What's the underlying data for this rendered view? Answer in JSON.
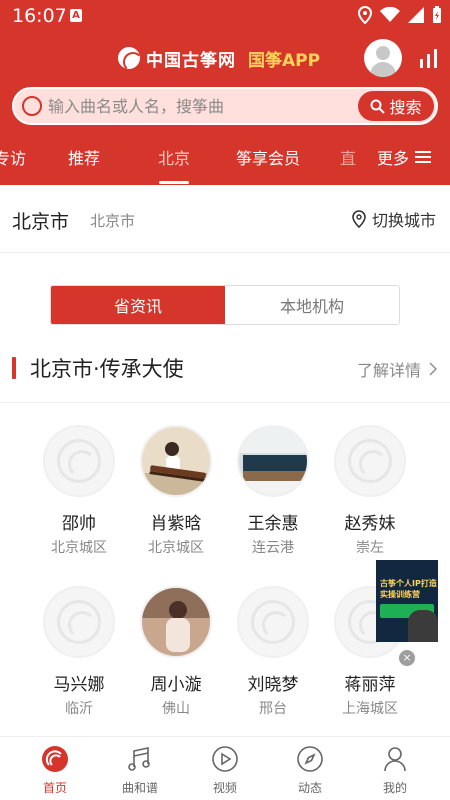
{
  "status": {
    "time": "16:07",
    "a_badge": "A"
  },
  "header": {
    "brand_name": "中国古筝网",
    "brand_app": "国筝APP"
  },
  "search": {
    "placeholder": "输入曲名或人名，搜筝曲",
    "button_label": "搜索"
  },
  "tabs": [
    {
      "label": "专访"
    },
    {
      "label": "推荐"
    },
    {
      "label": "北京",
      "active": true
    },
    {
      "label": "筝享会员"
    },
    {
      "label": "直"
    }
  ],
  "more_label": "更多",
  "city": {
    "name": "北京市",
    "sub": "北京市",
    "switch_label": "切换城市"
  },
  "segment": {
    "active": "省资讯",
    "inactive": "本地机构"
  },
  "section": {
    "title": "北京市·传承大使",
    "more": "了解详情"
  },
  "people": [
    {
      "name": "邵帅",
      "location": "北京城区",
      "photo": "placeholder-logo"
    },
    {
      "name": "肖紫晗",
      "location": "北京城区",
      "photo": "guzheng-player-photo"
    },
    {
      "name": "王余惠",
      "location": "连云港",
      "photo": "guzheng-instrument-photo"
    },
    {
      "name": "赵秀妹",
      "location": "崇左",
      "photo": "placeholder-logo"
    },
    {
      "name": "马兴娜",
      "location": "临沂",
      "photo": "placeholder-logo"
    },
    {
      "name": "周小漩",
      "location": "佛山",
      "photo": "player-portrait-photo"
    },
    {
      "name": "刘晓梦",
      "location": "邢台",
      "photo": "placeholder-logo"
    },
    {
      "name": "蒋丽萍",
      "location": "上海城区",
      "photo": "placeholder-logo"
    }
  ],
  "ad": {
    "text_line1": "古筝个人IP打造",
    "text_line2": "实操训练营",
    "close": "×"
  },
  "bottom_nav": [
    {
      "label": "首页",
      "icon": "home-icon",
      "active": true
    },
    {
      "label": "曲和谱",
      "icon": "score-icon"
    },
    {
      "label": "视频",
      "icon": "video-icon"
    },
    {
      "label": "动态",
      "icon": "compass-icon"
    },
    {
      "label": "我的",
      "icon": "profile-icon"
    }
  ],
  "colors": {
    "brand_red": "#d5352b",
    "brand_yellow": "#ffd35a"
  }
}
